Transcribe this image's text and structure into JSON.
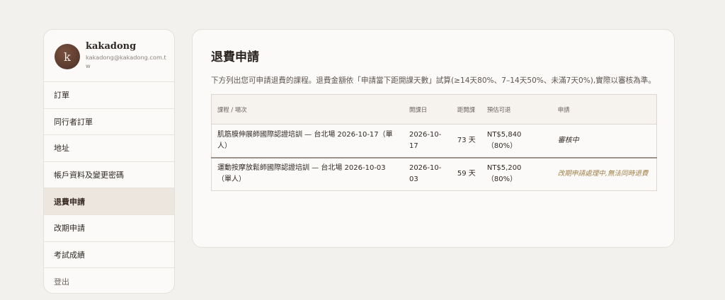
{
  "profile": {
    "avatar_letter": "k",
    "username": "kakadong",
    "email": "kakadong@kakadong.com.tw"
  },
  "nav": {
    "items": [
      {
        "label": "訂單"
      },
      {
        "label": "同行者訂單"
      },
      {
        "label": "地址"
      },
      {
        "label": "帳戶資料及變更密碼"
      },
      {
        "label": "退費申請"
      },
      {
        "label": "改期申請"
      },
      {
        "label": "考試成績"
      },
      {
        "label": "登出"
      }
    ],
    "active": "退費申請"
  },
  "main": {
    "title": "退費申請",
    "description": "下方列出您可申請退費的課程。退費金額依「申請當下距開課天數」試算(≥14天80%、7–14天50%、未滿7天0%),實際以審核為準。",
    "table": {
      "headers": {
        "course": "課程 / 場次",
        "start_date": "開課日",
        "days": "距開課",
        "estimate": "預估可退",
        "apply": "申請"
      },
      "rows": [
        {
          "course": "肌筋膜伸展師國際認證培訓 — 台北場 2026-10-17（單人）",
          "start_date": "2026-10-17",
          "days": "73 天",
          "estimate": "NT$5,840（80%）",
          "status": "審核中"
        },
        {
          "course": "運動按摩放鬆師國際認證培訓 — 台北場 2026-10-03（單人）",
          "start_date": "2026-10-03",
          "days": "59 天",
          "estimate": "NT$5,200（80%）",
          "status": "改期申請處理中,無法同時退費"
        }
      ]
    }
  },
  "colors": {
    "background": "#f3f1ed",
    "card": "#fbfaf8",
    "active_nav": "#ede6df",
    "note_text": "#a08149"
  }
}
